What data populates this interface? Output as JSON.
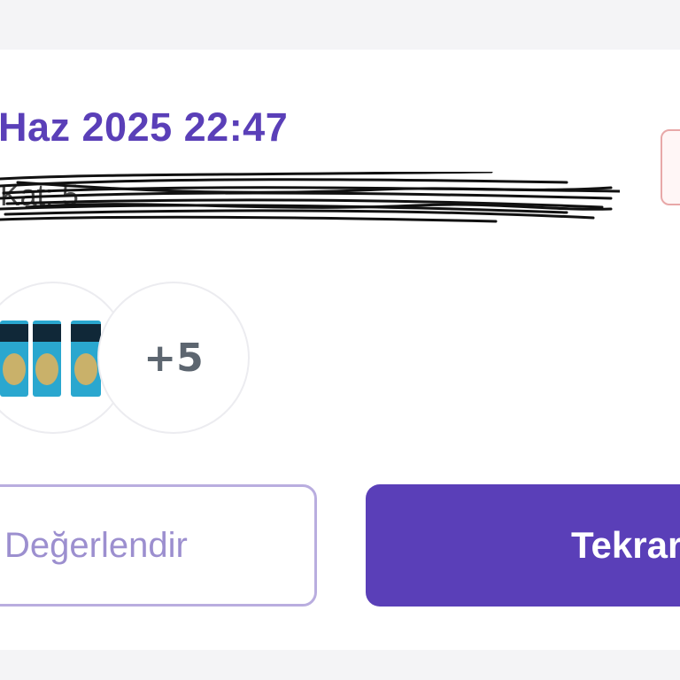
{
  "order": {
    "date_text": "Haz 2025 22:47",
    "address_text": "Kat: 5",
    "more_items": "+5"
  },
  "actions": {
    "rate_label": "Değerlendir",
    "reorder_label": "Tekrarla"
  },
  "icons": {
    "refresh": "refresh-icon"
  },
  "colors": {
    "accent": "#5a3fb8",
    "outline": "#b9addf",
    "badge_border": "#e8a8a8"
  }
}
